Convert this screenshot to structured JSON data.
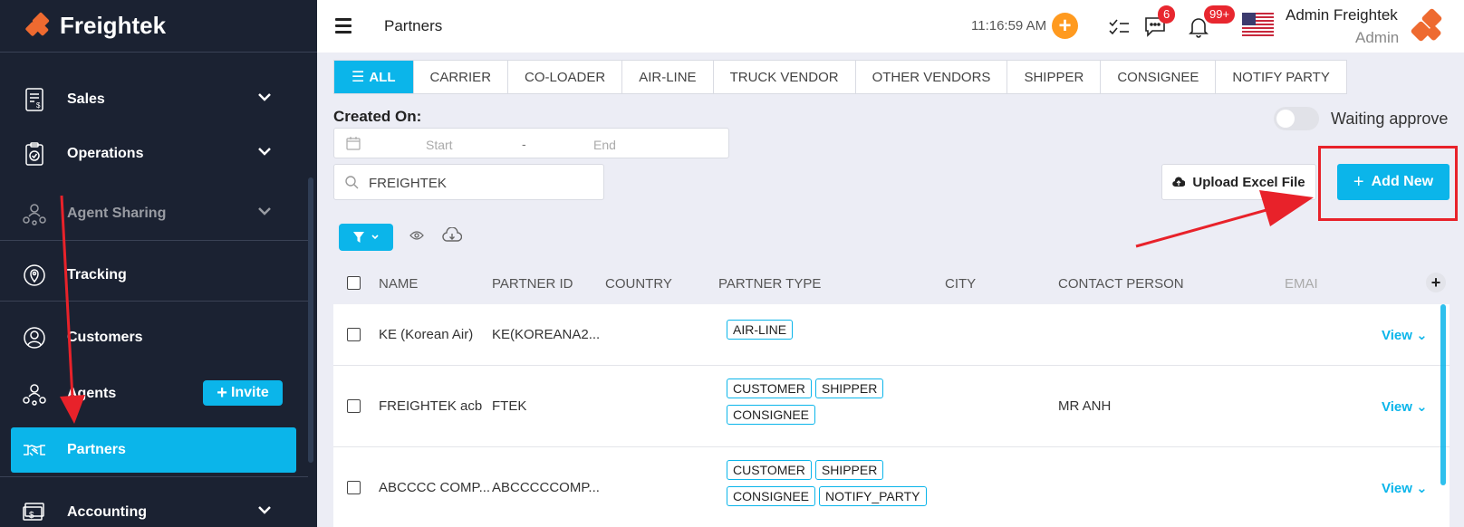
{
  "brand": {
    "name": "Freightek"
  },
  "sidebar": {
    "items": [
      {
        "label": "Sales",
        "icon": "invoice-icon",
        "expandable": true
      },
      {
        "label": "Operations",
        "icon": "clipboard-check-icon",
        "expandable": true
      },
      {
        "label": "Agent Sharing",
        "icon": "agent-network-icon",
        "expandable": true
      },
      {
        "label": "Tracking",
        "icon": "location-pin-icon",
        "expandable": false
      },
      {
        "label": "Customers",
        "icon": "customer-icon",
        "expandable": false
      },
      {
        "label": "Agents",
        "icon": "agent-network-icon",
        "expandable": false
      },
      {
        "label": "Partners",
        "icon": "handshake-icon",
        "expandable": false,
        "active": true
      },
      {
        "label": "Accounting",
        "icon": "money-icon",
        "expandable": true
      }
    ],
    "invite_label": "Invite"
  },
  "header": {
    "title": "Partners",
    "time": "11:16:59 AM",
    "chat_badge": "6",
    "notif_badge": "99+",
    "user_name": "Admin Freightek",
    "user_role": "Admin"
  },
  "tabs": [
    {
      "label": "ALL",
      "active": true
    },
    {
      "label": "CARRIER"
    },
    {
      "label": "CO-LOADER"
    },
    {
      "label": "AIR-LINE"
    },
    {
      "label": "TRUCK VENDOR"
    },
    {
      "label": "OTHER VENDORS"
    },
    {
      "label": "SHIPPER"
    },
    {
      "label": "CONSIGNEE"
    },
    {
      "label": "NOTIFY PARTY"
    }
  ],
  "filters": {
    "created_on_label": "Created On:",
    "start_placeholder": "Start",
    "separator": "-",
    "end_placeholder": "End",
    "search_value": "FREIGHTEK",
    "waiting_approve_label": "Waiting approve"
  },
  "actions": {
    "upload_label": "Upload Excel File",
    "add_new_label": "Add New"
  },
  "table": {
    "columns": [
      "NAME",
      "PARTNER ID",
      "COUNTRY",
      "PARTNER TYPE",
      "CITY",
      "CONTACT PERSON",
      "EMAI"
    ],
    "rows": [
      {
        "name": "KE (Korean Air)",
        "partner_id": "KE(KOREANA2...",
        "country": "",
        "types": [
          [
            "AIR-LINE"
          ]
        ],
        "city": "",
        "contact": "",
        "view": "View"
      },
      {
        "name": "FREIGHTEK acb",
        "partner_id": "FTEK",
        "country": "",
        "types": [
          [
            "CUSTOMER",
            "SHIPPER"
          ],
          [
            "CONSIGNEE"
          ]
        ],
        "city": "",
        "contact": "MR ANH",
        "view": "View"
      },
      {
        "name": "ABCCCC COMP...",
        "partner_id": "ABCCCCCOMP...",
        "country": "",
        "types": [
          [
            "CUSTOMER",
            "SHIPPER"
          ],
          [
            "CONSIGNEE",
            "NOTIFY_PARTY"
          ]
        ],
        "city": "",
        "contact": "",
        "view": "View"
      }
    ]
  },
  "colors": {
    "accent": "#0bb5ea",
    "sidebar_bg": "#1b2232",
    "brand_orange": "#ee6a30",
    "annotation_red": "#e8222a"
  }
}
